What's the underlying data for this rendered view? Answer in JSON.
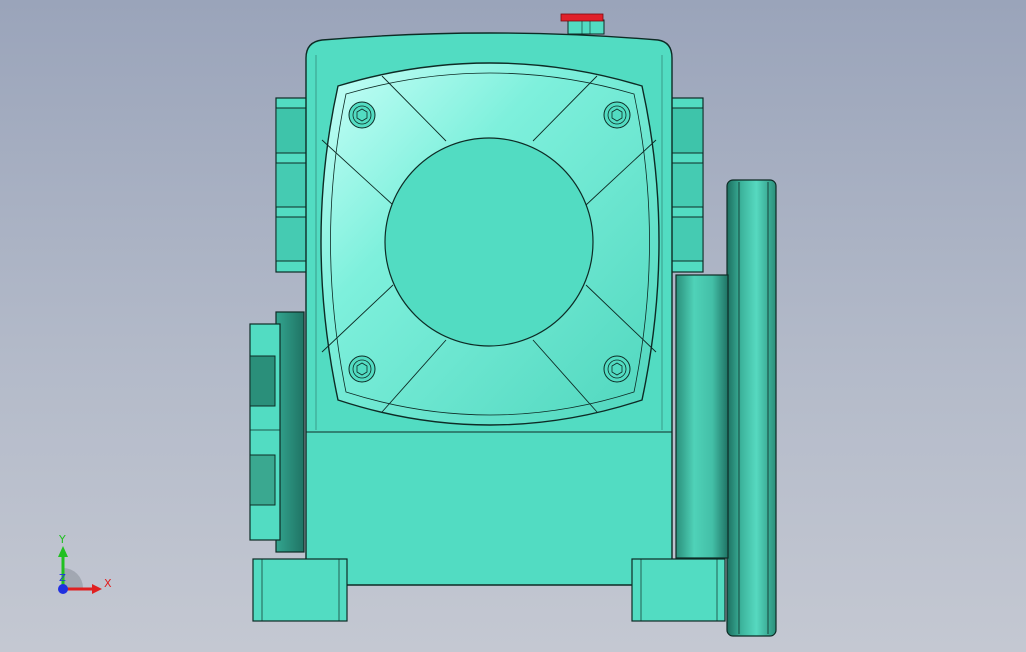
{
  "viewport": {
    "background_top": "#9aa4ba",
    "background_bottom": "#c4c8d2"
  },
  "model": {
    "name": "worm-gear-reducer",
    "body_color": "#52dcc2",
    "cover_highlight": "#c8fff8",
    "dark_shade": "#2a8f7a",
    "edge_color": "#0d2b25",
    "plug_color": "#e0202a",
    "visible_bolts": 4
  },
  "triad": {
    "x_label": "X",
    "y_label": "Y",
    "z_label": "Z",
    "x_color": "#e02020",
    "y_color": "#20c020",
    "z_color": "#2030e0"
  }
}
